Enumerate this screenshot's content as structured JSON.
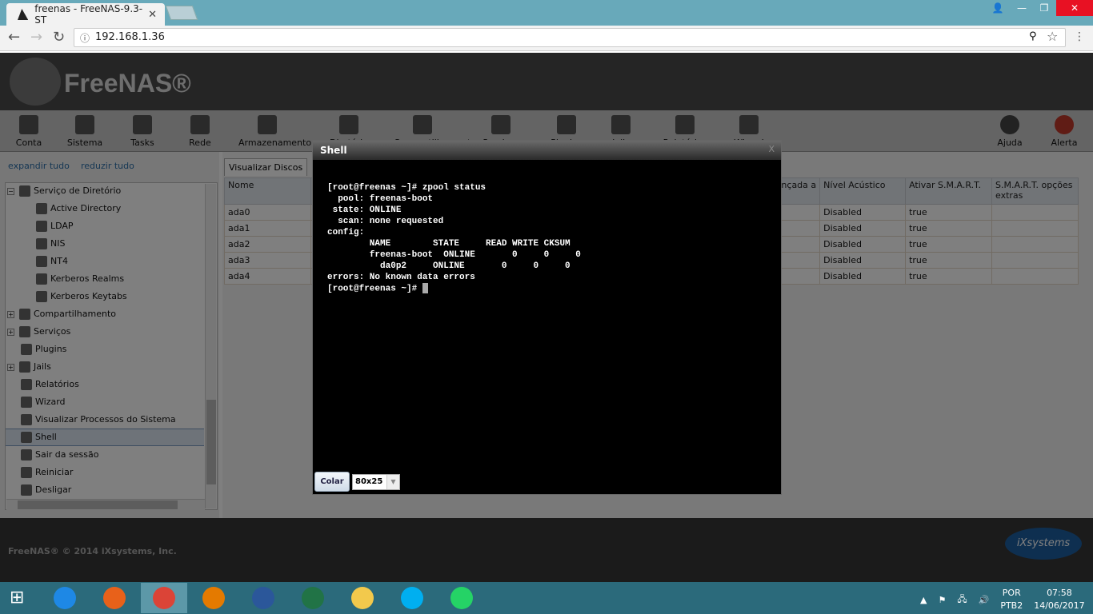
{
  "browser": {
    "tab_title": "freenas - FreeNAS-9.3-ST",
    "url": "192.168.1.36"
  },
  "app": {
    "logo": "FreeNAS®"
  },
  "toolbar": [
    "Conta",
    "Sistema",
    "Tasks",
    "Rede",
    "Armazenamento",
    "Diretório",
    "Compartilhamentos",
    "Serviços",
    "Plugins",
    "Jails",
    "Relatórios",
    "Wizard"
  ],
  "toolbar_right": [
    "Ajuda",
    "Alerta"
  ],
  "left": {
    "expand": "expandir tudo",
    "collapse": "reduzir tudo",
    "tree": [
      "Serviço de Diretório",
      "Active Directory",
      "LDAP",
      "NIS",
      "NT4",
      "Kerberos Realms",
      "Kerberos Keytabs",
      "Compartilhamento",
      "Serviços",
      "Plugins",
      "Jails",
      "Relatórios",
      "Wizard",
      "Visualizar Processos do Sistema",
      "Shell",
      "Sair da sessão",
      "Reiniciar",
      "Desligar"
    ]
  },
  "main": {
    "tab": "Visualizar Discos",
    "columns": [
      "Nome",
      "vançada a",
      "Nível Acústico",
      "Ativar S.M.A.R.T.",
      "S.M.A.R.T. opções extras"
    ],
    "rows": [
      [
        "ada0",
        "Disabled",
        "true"
      ],
      [
        "ada1",
        "Disabled",
        "true"
      ],
      [
        "ada2",
        "Disabled",
        "true"
      ],
      [
        "ada3",
        "Disabled",
        "true"
      ],
      [
        "ada4",
        "Disabled",
        "true"
      ]
    ]
  },
  "shell": {
    "title": "Shell",
    "close": "X",
    "paste": "Colar",
    "size": "80x25",
    "lines": [
      "[root@freenas ~]# zpool status",
      "  pool: freenas-boot",
      " state: ONLINE",
      "  scan: none requested",
      "config:",
      "",
      "        NAME        STATE     READ WRITE CKSUM",
      "        freenas-boot  ONLINE       0     0     0",
      "          da0p2     ONLINE       0     0     0",
      "",
      "errors: No known data errors",
      "[root@freenas ~]# "
    ]
  },
  "footer": {
    "copyright": "FreeNAS® © 2014 iXsystems, Inc.",
    "brand": "iXsystems"
  },
  "taskbar": {
    "lang1": "POR",
    "lang2": "PTB2",
    "time": "07:58",
    "date": "14/06/2017"
  }
}
